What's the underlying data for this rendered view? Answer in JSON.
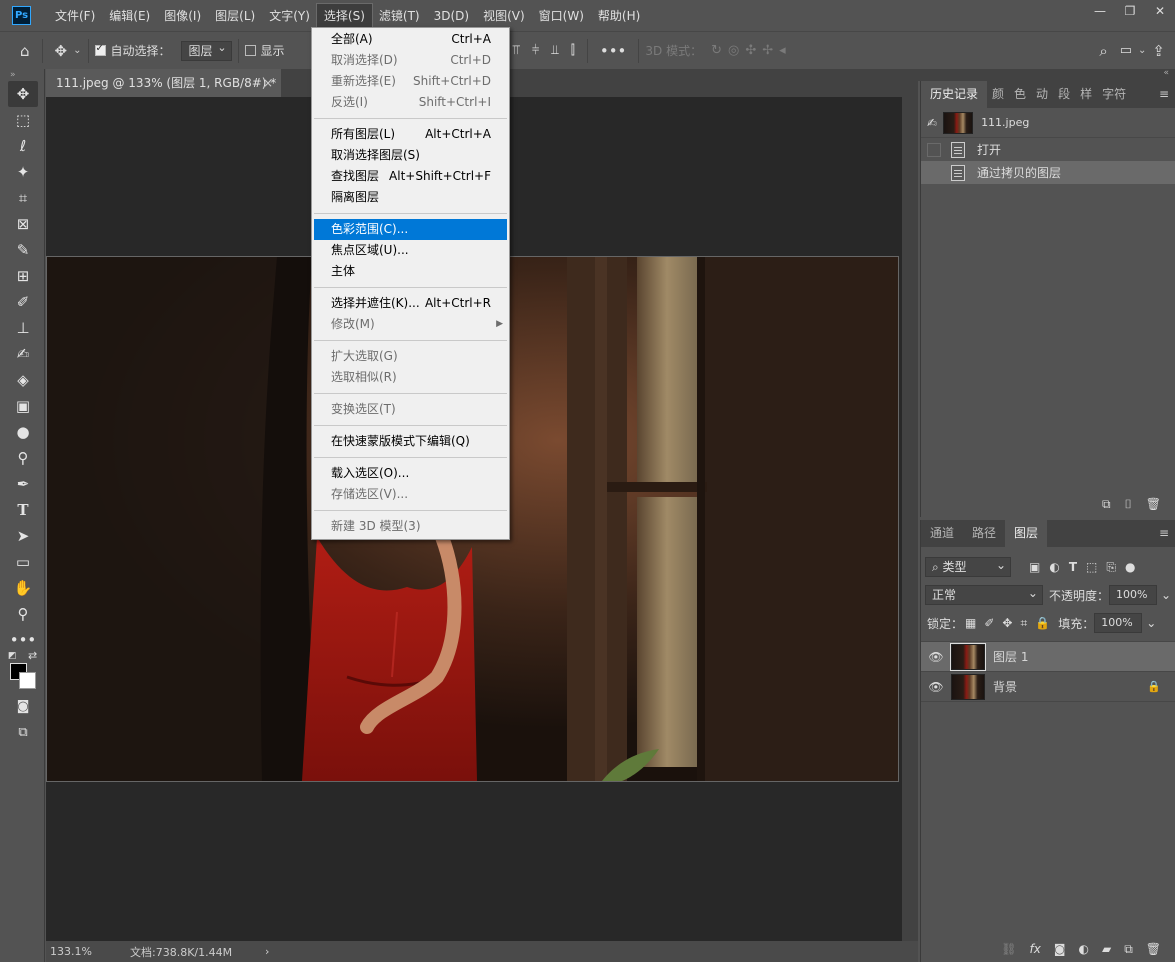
{
  "app": {
    "logo": "Ps"
  },
  "menubar": {
    "items": [
      "文件(F)",
      "编辑(E)",
      "图像(I)",
      "图层(L)",
      "文字(Y)",
      "选择(S)",
      "滤镜(T)",
      "3D(D)",
      "视图(V)",
      "窗口(W)",
      "帮助(H)"
    ],
    "active_index": 5
  },
  "window_controls": {
    "minimize": "—",
    "restore": "❐",
    "close": "✕"
  },
  "options": {
    "auto_select_label": "自动选择：",
    "auto_select_checked": true,
    "auto_select_target": "图层",
    "show_label": "显示",
    "mode_3d_label": "3D 模式："
  },
  "document": {
    "tab_title": "111.jpeg @ 133% (图层 1, RGB/8#) *",
    "close": "×"
  },
  "status": {
    "zoom": "133.1%",
    "doc_info": "文档:738.8K/1.44M",
    "arrow": "›"
  },
  "select_menu": {
    "groups": [
      [
        {
          "label": "全部(A)",
          "shortcut": "Ctrl+A",
          "enabled": true
        },
        {
          "label": "取消选择(D)",
          "shortcut": "Ctrl+D",
          "enabled": false
        },
        {
          "label": "重新选择(E)",
          "shortcut": "Shift+Ctrl+D",
          "enabled": false
        },
        {
          "label": "反选(I)",
          "shortcut": "Shift+Ctrl+I",
          "enabled": false
        }
      ],
      [
        {
          "label": "所有图层(L)",
          "shortcut": "Alt+Ctrl+A",
          "enabled": true
        },
        {
          "label": "取消选择图层(S)",
          "shortcut": "",
          "enabled": true
        },
        {
          "label": "查找图层",
          "shortcut": "Alt+Shift+Ctrl+F",
          "enabled": true
        },
        {
          "label": "隔离图层",
          "shortcut": "",
          "enabled": true
        }
      ],
      [
        {
          "label": "色彩范围(C)...",
          "shortcut": "",
          "enabled": true,
          "highlight": true
        },
        {
          "label": "焦点区域(U)...",
          "shortcut": "",
          "enabled": true
        },
        {
          "label": "主体",
          "shortcut": "",
          "enabled": true
        }
      ],
      [
        {
          "label": "选择并遮住(K)...",
          "shortcut": "Alt+Ctrl+R",
          "enabled": true
        },
        {
          "label": "修改(M)",
          "shortcut": "",
          "enabled": false,
          "submenu": true
        }
      ],
      [
        {
          "label": "扩大选取(G)",
          "shortcut": "",
          "enabled": false
        },
        {
          "label": "选取相似(R)",
          "shortcut": "",
          "enabled": false
        }
      ],
      [
        {
          "label": "变换选区(T)",
          "shortcut": "",
          "enabled": false
        }
      ],
      [
        {
          "label": "在快速蒙版模式下编辑(Q)",
          "shortcut": "",
          "enabled": true
        }
      ],
      [
        {
          "label": "载入选区(O)...",
          "shortcut": "",
          "enabled": true
        },
        {
          "label": "存储选区(V)...",
          "shortcut": "",
          "enabled": false
        }
      ],
      [
        {
          "label": "新建 3D 模型(3)",
          "shortcut": "",
          "enabled": false
        }
      ]
    ]
  },
  "history_panel": {
    "tabs": [
      "历史记录",
      "颜",
      "色",
      "动",
      "段",
      "样",
      "字符"
    ],
    "snapshot": "111.jpeg",
    "steps": [
      "打开",
      "通过拷贝的图层"
    ],
    "selected_step": 1
  },
  "layers_panel": {
    "tabs": [
      "通道",
      "路径",
      "图层"
    ],
    "active_tab": 2,
    "filter": "类型",
    "blend_mode": "正常",
    "opacity_label": "不透明度：",
    "opacity": "100%",
    "lock_label": "锁定：",
    "fill_label": "填充：",
    "fill": "100%",
    "layers": [
      {
        "name": "图层 1",
        "selected": true,
        "locked": false
      },
      {
        "name": "背景",
        "selected": false,
        "locked": true
      }
    ]
  }
}
